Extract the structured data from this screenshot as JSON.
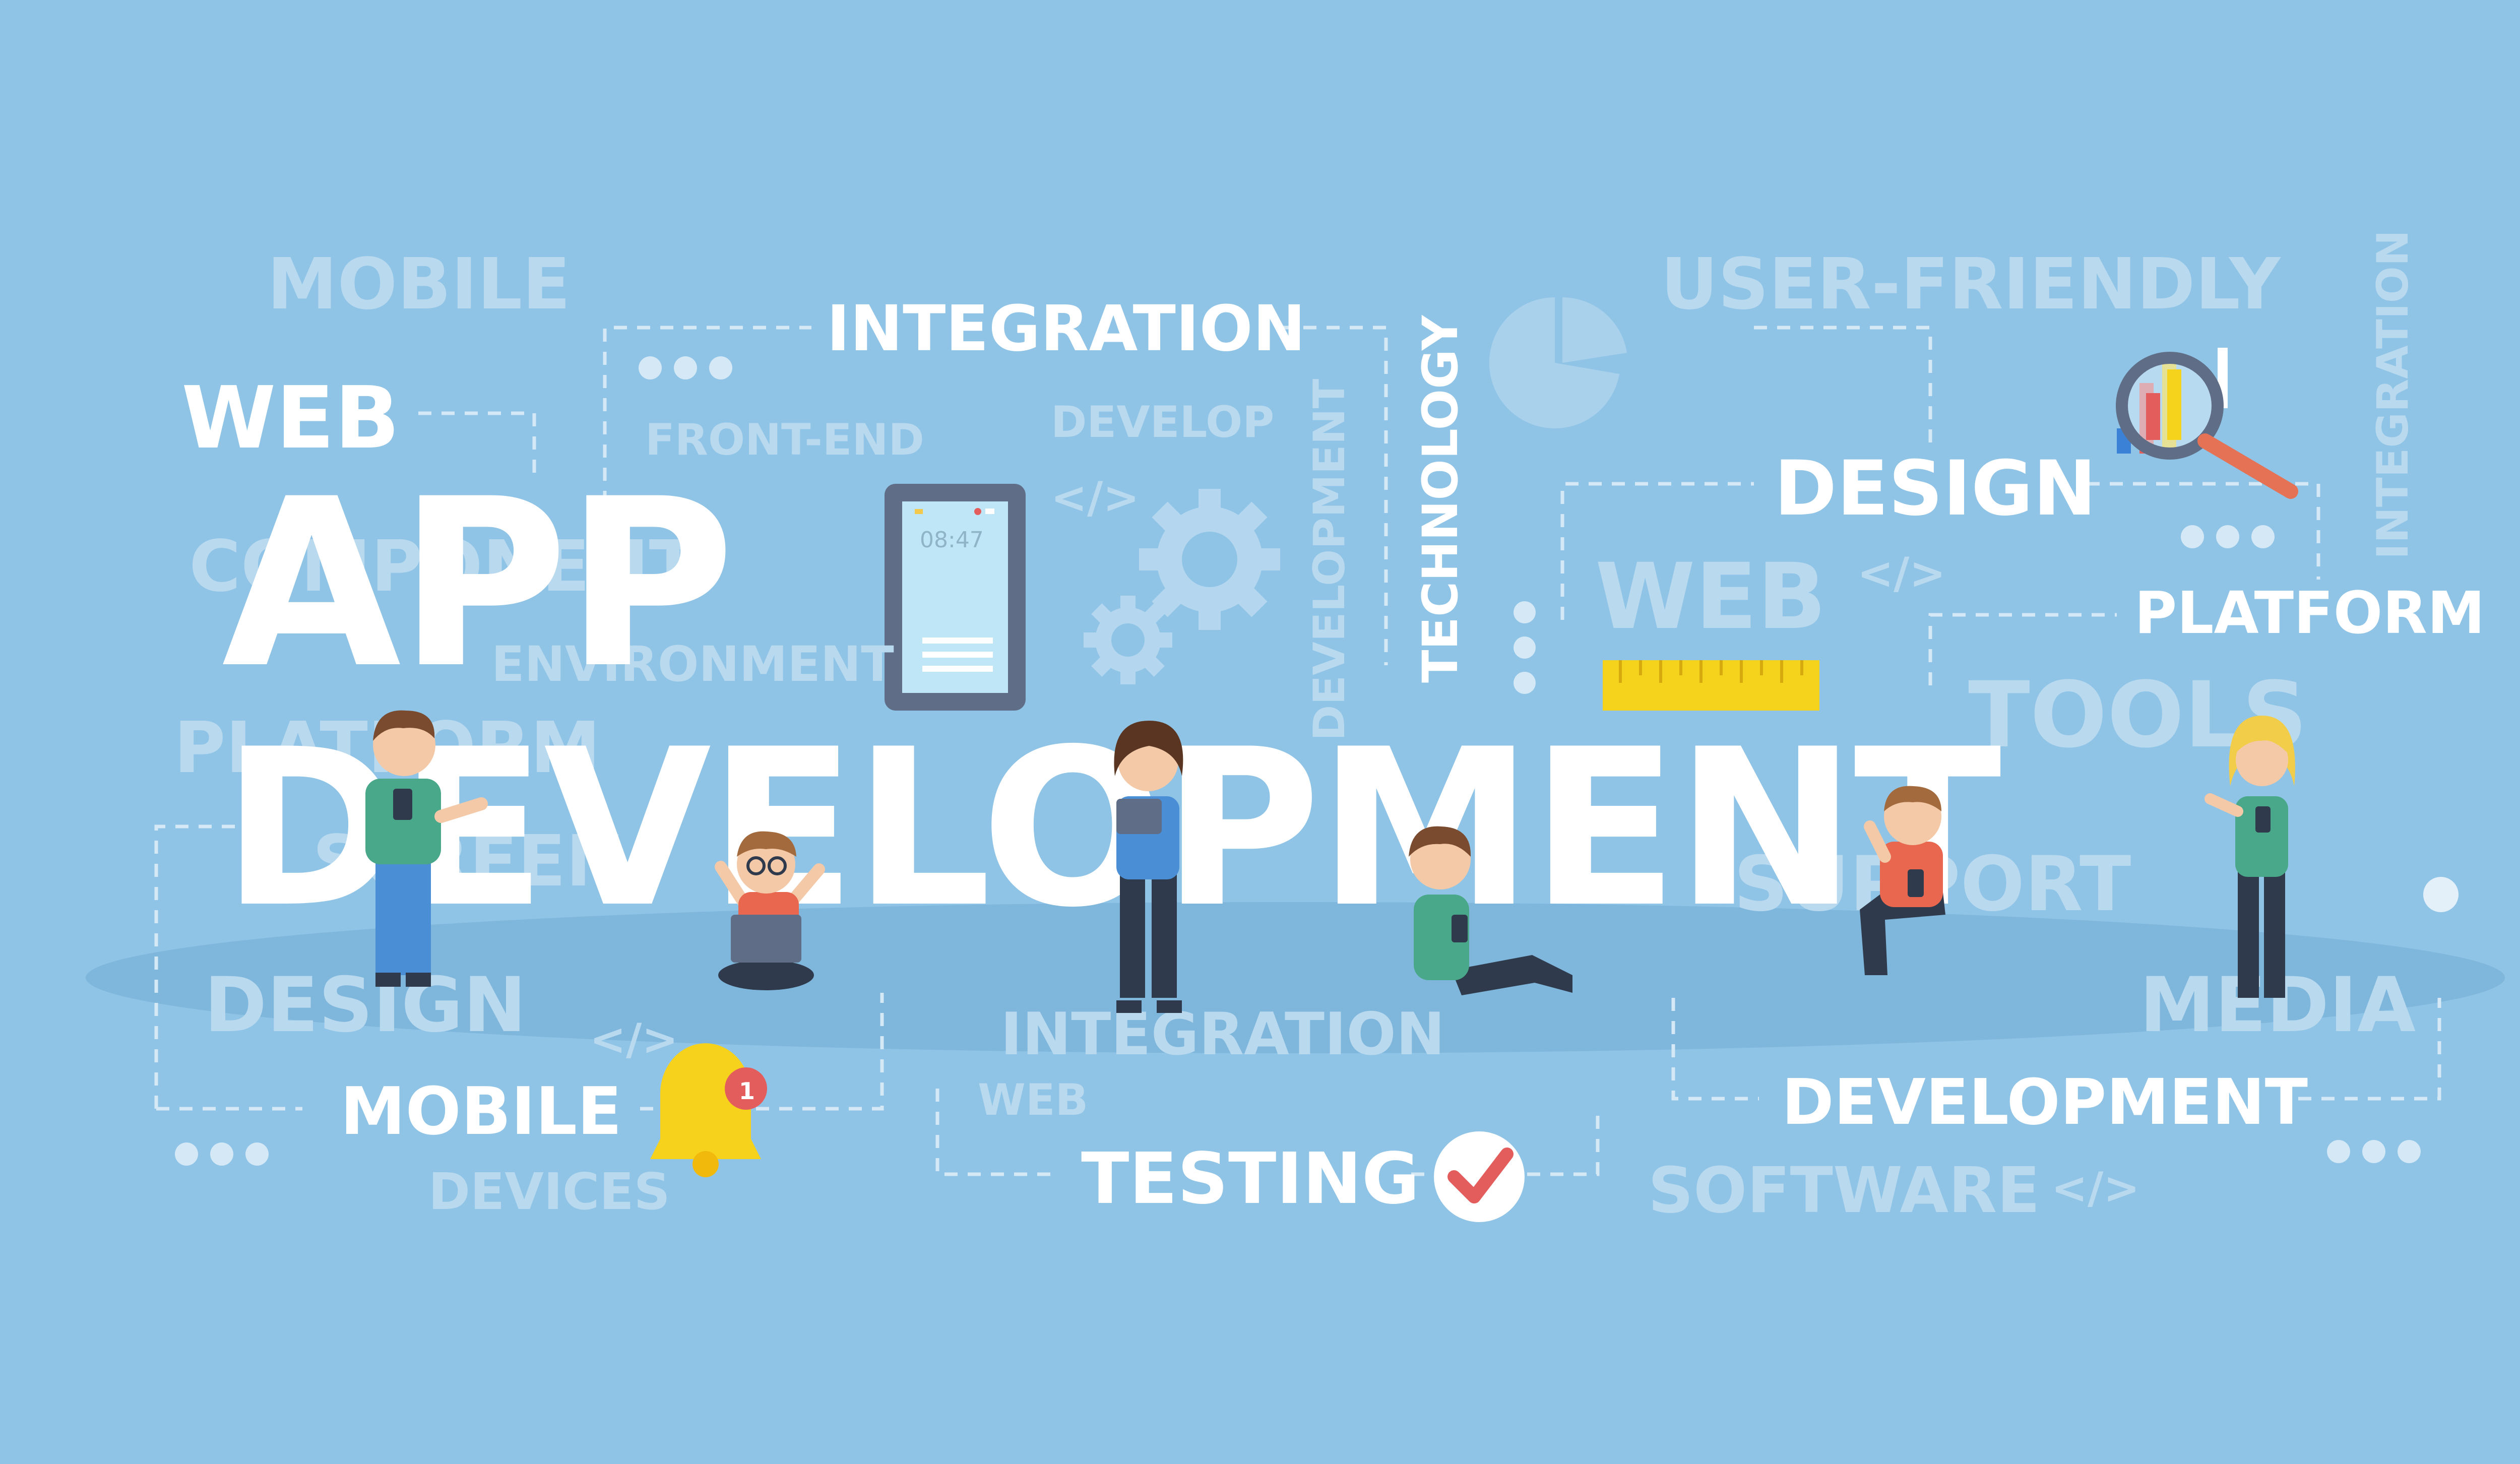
{
  "title": {
    "line1": "APP",
    "line2": "DEVELOPMENT"
  },
  "labels": {
    "integration": "INTEGRATION",
    "web": "WEB",
    "technology": "TECHNOLOGY",
    "design": "DESIGN",
    "platform": "PLATFORM",
    "mobile": "MOBILE",
    "testing": "TESTING",
    "development": "DEVELOPMENT"
  },
  "faded": {
    "mobile": "MOBILE",
    "front_end": "FRONT-END",
    "develop": "DEVELOP",
    "development_vertical": "DEVELOPMENT",
    "user_friendly": "USER-FRIENDLY",
    "integration_vertical": "INTEGRATION",
    "web": "WEB",
    "component": "COMPONENT",
    "environment": "ENVIRONMENT",
    "platform": "PLATFORM",
    "screen": "SCREEN",
    "design": "DESIGN",
    "integration": "INTEGRATION",
    "web_small": "WEB",
    "devices": "DEVICES",
    "software": "SOFTWARE",
    "tools": "TOOLS",
    "support": "SUPPORT",
    "media": "MEDIA",
    "code1": "</>",
    "code2": "</>",
    "code3": "</>",
    "code4": "</>"
  },
  "tablet": {
    "time": "08:47"
  },
  "bell": {
    "badge": "1"
  },
  "colors": {
    "background": "#8fc4e6",
    "text": "#ffffff",
    "faded_text": "#b9d9ef",
    "ruler": "#f5d21b",
    "bell": "#f7d21c",
    "check": "#e45d5d"
  },
  "icons": [
    "tablet-icon",
    "gear-icon",
    "pie-chart-icon",
    "magnifier-chart-icon",
    "ruler-icon",
    "bell-icon",
    "check-icon",
    "dots-icon"
  ]
}
